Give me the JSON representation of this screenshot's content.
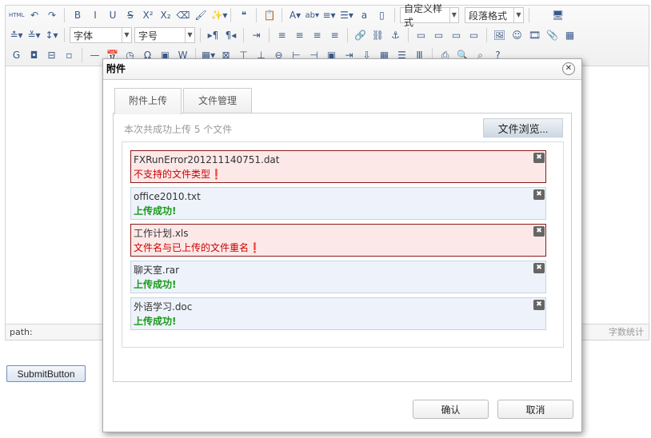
{
  "toolbar": {
    "row1": [
      [
        "html-source",
        "HTML"
      ],
      [
        "undo",
        "↶"
      ],
      [
        "redo",
        "↷"
      ],
      [
        "sep"
      ],
      [
        "bold",
        "B"
      ],
      [
        "italic",
        "I"
      ],
      [
        "underline",
        "U"
      ],
      [
        "strikethrough",
        "S̶"
      ],
      [
        "superscript",
        "X²"
      ],
      [
        "subscript",
        "X₂"
      ],
      [
        "eraser",
        "⌫"
      ],
      [
        "format-brush",
        "🖌"
      ],
      [
        "auto-typeset",
        "✨▾"
      ],
      [
        "sep"
      ],
      [
        "blockquote",
        "❝"
      ],
      [
        "sep"
      ],
      [
        "paste-plain",
        "📋"
      ],
      [
        "sep"
      ],
      [
        "font-color",
        "A▾"
      ],
      [
        "highlight",
        "ab▾"
      ],
      [
        "ordered-list",
        "≡▾"
      ],
      [
        "unordered-list",
        "☰▾"
      ],
      [
        "select-all",
        "a"
      ],
      [
        "clear-doc",
        "▯"
      ],
      [
        "sep"
      ]
    ],
    "row1b": [
      [
        "fullscreen",
        "🖥"
      ]
    ],
    "row2a": [
      [
        "row-spacing-top",
        "≛▾"
      ],
      [
        "row-spacing-bottom",
        "≚▾"
      ],
      [
        "line-height",
        "↕▾"
      ],
      [
        "sep"
      ]
    ],
    "row2b": [
      [
        "sep"
      ],
      [
        "ltr",
        "▸¶"
      ],
      [
        "rtl",
        "¶◂"
      ],
      [
        "sep"
      ],
      [
        "indent",
        "⇥"
      ],
      [
        "sep"
      ],
      [
        "justify-left",
        "≡"
      ],
      [
        "justify-center",
        "≡"
      ],
      [
        "justify-right",
        "≡"
      ],
      [
        "justify-full",
        "≡"
      ],
      [
        "sep"
      ],
      [
        "link",
        "🔗"
      ],
      [
        "unlink",
        "⛓"
      ],
      [
        "anchor",
        "⚓"
      ],
      [
        "sep"
      ],
      [
        "image-none",
        "▭"
      ],
      [
        "image-left",
        "▭"
      ],
      [
        "image-right",
        "▭"
      ],
      [
        "image-center",
        "▭"
      ],
      [
        "sep"
      ],
      [
        "insert-image",
        "🖼"
      ],
      [
        "emotion",
        "☺"
      ],
      [
        "video",
        "🎞"
      ],
      [
        "attachment",
        "📎"
      ],
      [
        "map",
        "▦"
      ]
    ],
    "row3": [
      [
        "google-map",
        "G"
      ],
      [
        "insert-frame",
        "◘"
      ],
      [
        "page-break",
        "⊟"
      ],
      [
        "template",
        "▫"
      ],
      [
        "sep"
      ],
      [
        "horizontal",
        "—"
      ],
      [
        "date",
        "📅"
      ],
      [
        "time",
        "◷"
      ],
      [
        "spechars",
        "Ω"
      ],
      [
        "wordimage",
        "▣"
      ],
      [
        "word-import",
        "W"
      ],
      [
        "sep"
      ],
      [
        "insert-table",
        "▦▾"
      ],
      [
        "delete-table",
        "⊠"
      ],
      [
        "insert-para-before",
        "⊤"
      ],
      [
        "insert-row",
        "⊥"
      ],
      [
        "delete-row",
        "⊖"
      ],
      [
        "insert-col",
        "⊢"
      ],
      [
        "delete-col",
        "⊣"
      ],
      [
        "merge-cells",
        "▣"
      ],
      [
        "merge-right",
        "⇥"
      ],
      [
        "merge-down",
        "⇩"
      ],
      [
        "split-cells",
        "▦"
      ],
      [
        "split-rows",
        "☰"
      ],
      [
        "split-cols",
        "Ⅲ"
      ],
      [
        "sep"
      ],
      [
        "print",
        "⎙"
      ],
      [
        "preview",
        "🔍"
      ],
      [
        "search-replace",
        "⌕"
      ],
      [
        "help",
        "?"
      ]
    ],
    "font_family": "字体",
    "font_size": "字号",
    "custom_style": "自定义样式",
    "paragraph": "段落格式"
  },
  "editor": {
    "path_label": "path:",
    "word_count": "字数统计"
  },
  "submit_label": "SubmitButton",
  "dialog": {
    "title": "附件",
    "tabs": [
      "附件上传",
      "文件管理"
    ],
    "info": "本次共成功上传 5 个文件",
    "browse": "文件浏览...",
    "files": [
      {
        "name": "FXRunError201211140751.dat",
        "status": "不支持的文件类型❗",
        "state": "err"
      },
      {
        "name": "office2010.txt",
        "status": "上传成功!",
        "state": "ok"
      },
      {
        "name": "工作计划.xls",
        "status": "文件名与已上传的文件重名❗",
        "state": "err"
      },
      {
        "name": "聊天室.rar",
        "status": "上传成功!",
        "state": "ok"
      },
      {
        "name": "外语学习.doc",
        "status": "上传成功!",
        "state": "ok"
      }
    ],
    "ok": "确认",
    "cancel": "取消"
  }
}
